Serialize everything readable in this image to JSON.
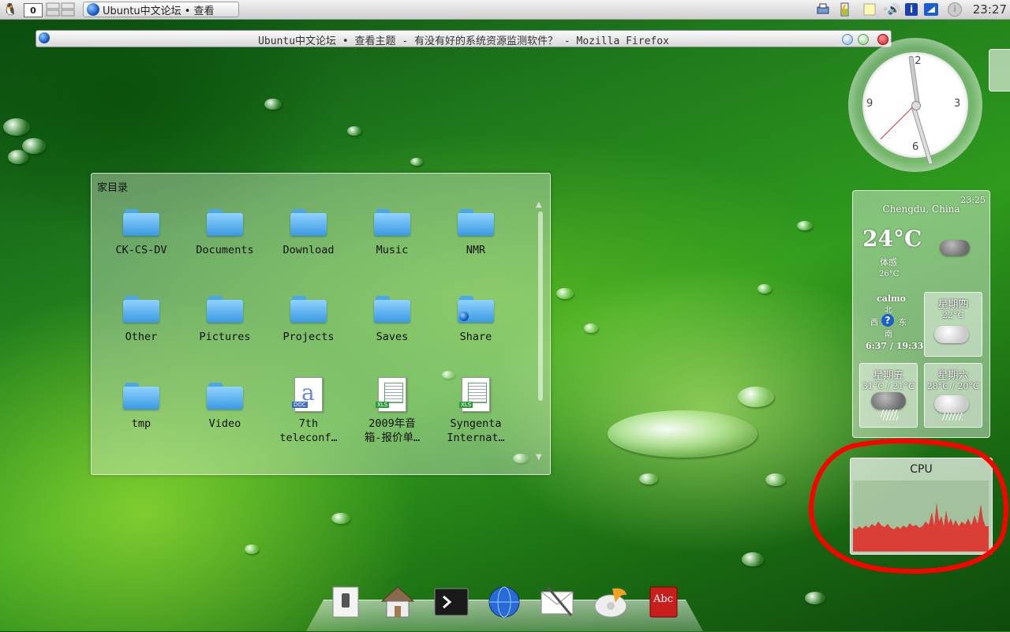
{
  "top_panel": {
    "workspace_number": "0",
    "task_button_label": "Ubuntu中文论坛 • 查看",
    "clock": "23:27",
    "icons": [
      "qq-penguin-icon",
      "pager-icon",
      "globe-icon",
      "printer-icon",
      "battery-icon",
      "notes-icon",
      "volume-icon",
      "info-icon",
      "network-icon",
      "info-circle-icon"
    ]
  },
  "firefox": {
    "title": "Ubuntu中文论坛 • 查看主题 - 有没有好的系统资源监测软件？ - Mozilla Firefox"
  },
  "folder_view": {
    "title": "家目录",
    "items": [
      {
        "label": "CK-CS-DV",
        "type": "folder"
      },
      {
        "label": "Documents",
        "type": "folder"
      },
      {
        "label": "Download",
        "type": "folder"
      },
      {
        "label": "Music",
        "type": "folder"
      },
      {
        "label": "NMR",
        "type": "folder"
      },
      {
        "label": "Other",
        "type": "folder"
      },
      {
        "label": "Pictures",
        "type": "folder"
      },
      {
        "label": "Projects",
        "type": "folder"
      },
      {
        "label": "Saves",
        "type": "folder"
      },
      {
        "label": "Share",
        "type": "folder"
      },
      {
        "label": "tmp",
        "type": "folder"
      },
      {
        "label": "Video",
        "type": "folder"
      },
      {
        "label": "7th",
        "label2": "teleconf…",
        "type": "doc",
        "badge": "DOC"
      },
      {
        "label": "2009年音",
        "label2": "箱-报价单…",
        "type": "xls",
        "badge": "XLS"
      },
      {
        "label": "Syngenta",
        "label2": "Internat…",
        "type": "xls",
        "badge": "XLS"
      }
    ]
  },
  "clock_widget": {
    "numbers": [
      "12",
      "3",
      "6",
      "9"
    ]
  },
  "weather": {
    "location": "Chengdu, China",
    "time": "23:25",
    "temp": "24°C",
    "feels_label": "体感",
    "feels_temp": "26°C",
    "wind": "calmo",
    "compass": {
      "n": "北",
      "w": "西",
      "e": "东",
      "s": "南"
    },
    "sun": "6:37 / 19:33",
    "days": [
      {
        "name": "星期四",
        "temp": "22°C"
      },
      {
        "name": "星期五",
        "temp": "31°C / 21°C"
      },
      {
        "name": "星期六",
        "temp": "28°C / 20°C"
      }
    ]
  },
  "cpu_widget": {
    "title": "CPU",
    "graph_color": "#e0302a"
  },
  "dock": {
    "icons": [
      "switch-icon",
      "home-icon",
      "terminal-icon",
      "browser-globe-icon",
      "mail-icon",
      "media-player-icon",
      "dictionary-icon"
    ],
    "dictionary_text": "Abc"
  },
  "colors": {
    "annotation_red": "#ff0000",
    "folder_blue": "#3a9ae0"
  }
}
